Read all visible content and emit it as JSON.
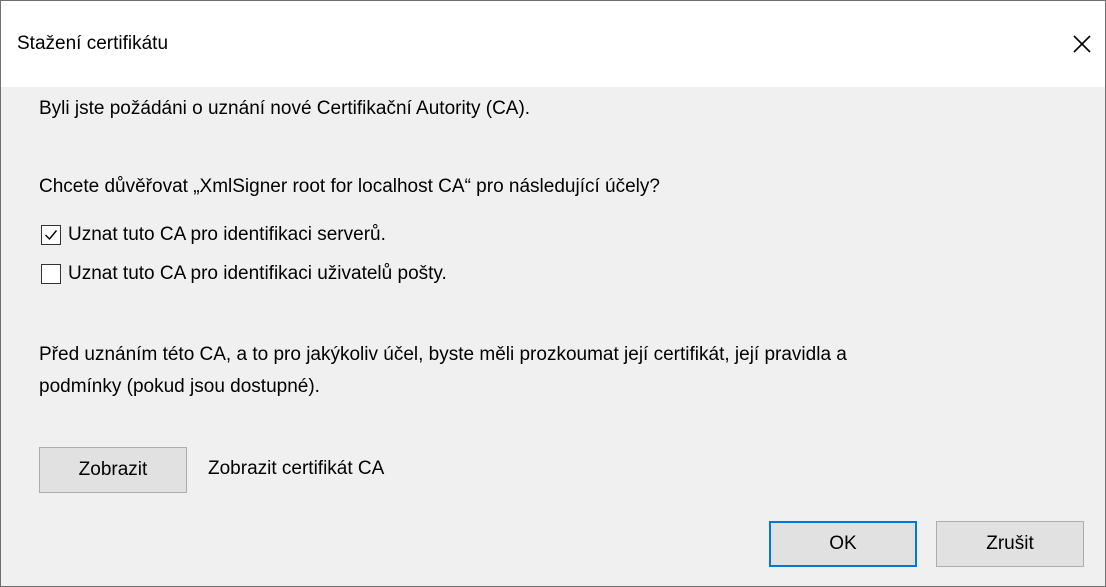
{
  "dialog": {
    "title": "Stažení certifikátu",
    "intro": "Byli jste požádáni o uznání nové Certifikační Autority (CA).",
    "question": "Chcete důvěřovat „XmlSigner root for localhost CA“ pro následující účely?",
    "options": [
      {
        "label": "Uznat tuto CA pro identifikaci serverů.",
        "checked": true
      },
      {
        "label": "Uznat tuto CA pro identifikaci uživatelů pošty.",
        "checked": false
      }
    ],
    "advice_line1": "Před uznáním této CA, a to pro jakýkoliv účel, byste měli prozkoumat její certifikát, její pravidla a",
    "advice_line2": "podmínky (pokud jsou dostupné).",
    "view_button": "Zobrazit",
    "view_label": "Zobrazit certifikát CA",
    "ok_button": "OK",
    "cancel_button": "Zrušit"
  },
  "colors": {
    "dialog_background": "#f0f0f0",
    "titlebar_background": "#ffffff",
    "button_background": "#e1e1e1",
    "default_button_border": "#0078d7"
  },
  "icons": {
    "close": "close-icon",
    "checkmark": "checkmark-icon"
  }
}
